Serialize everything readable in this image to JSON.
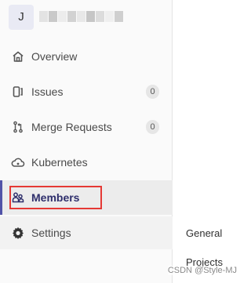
{
  "project": {
    "avatar_letter": "J"
  },
  "nav": {
    "overview": "Overview",
    "issues": "Issues",
    "issues_count": "0",
    "merge_requests": "Merge Requests",
    "merge_requests_count": "0",
    "kubernetes": "Kubernetes",
    "members": "Members",
    "settings": "Settings"
  },
  "flyout": {
    "items": [
      "General",
      "Projects"
    ]
  },
  "watermark": "CSDN @Style-MJ",
  "colors": {
    "active_indicator": "#5153a8",
    "highlight_outline": "#e53935",
    "sidebar_bg": "#fafafa"
  }
}
